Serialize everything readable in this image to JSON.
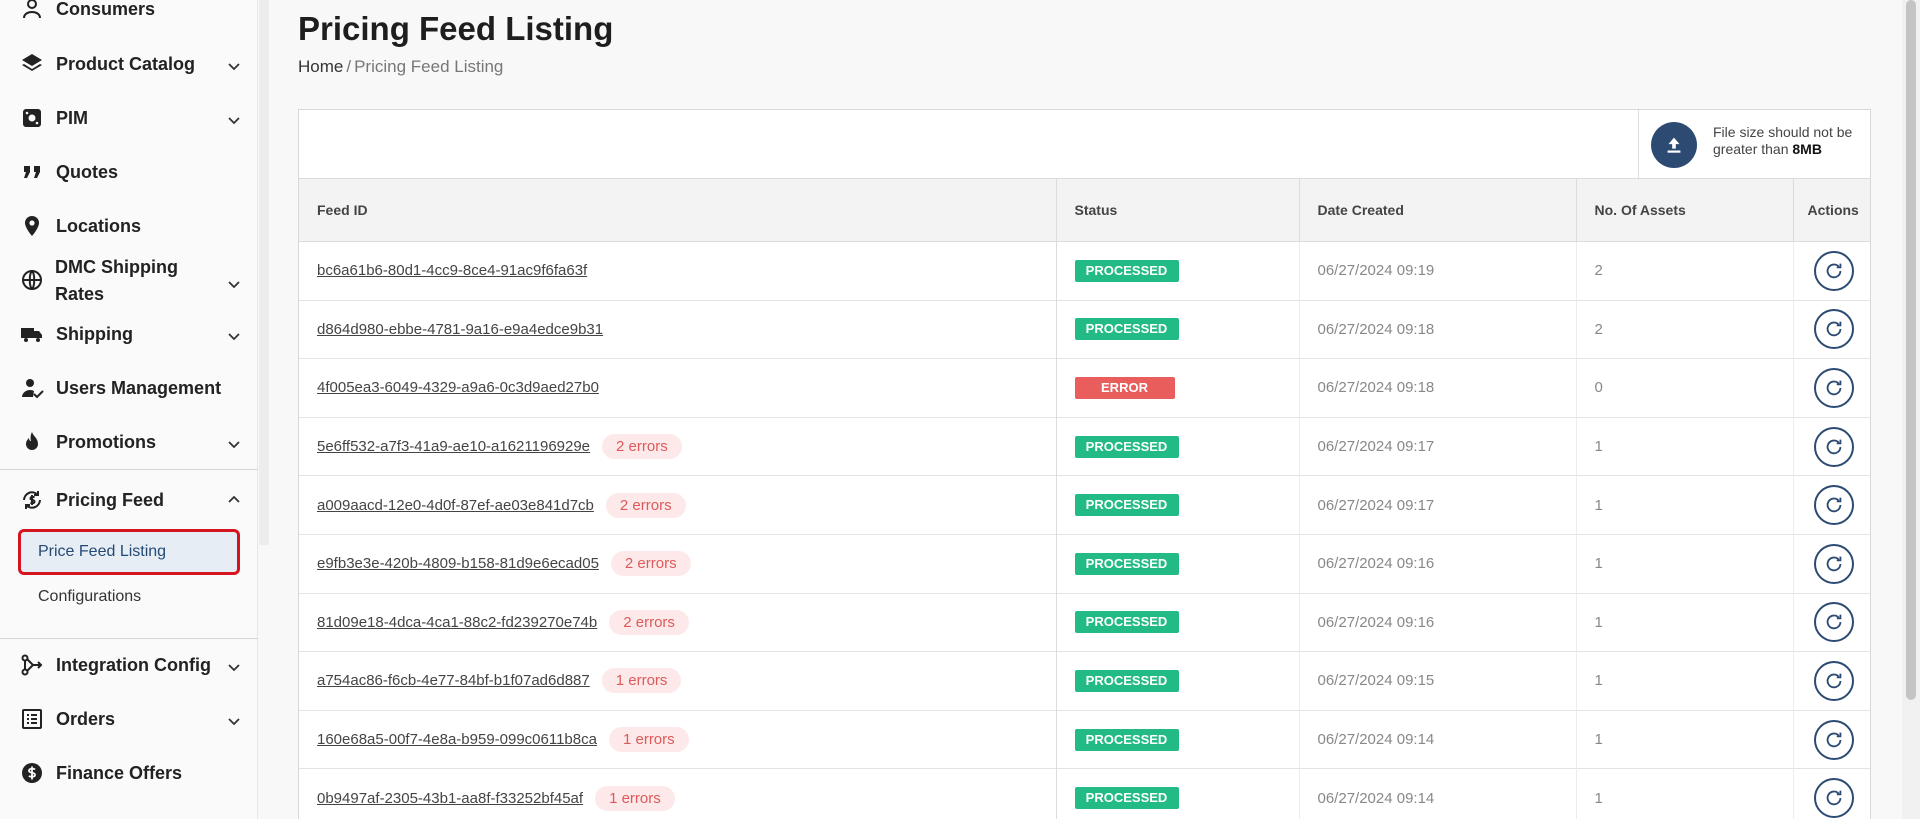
{
  "sidebar": {
    "items": [
      {
        "label": "Consumers",
        "icon": "user-icon",
        "chevron": false
      },
      {
        "label": "Product Catalog",
        "icon": "layers-icon",
        "chevron": true
      },
      {
        "label": "PIM",
        "icon": "pim-icon",
        "chevron": true
      },
      {
        "label": "Quotes",
        "icon": "quote-icon",
        "chevron": false
      },
      {
        "label": "Locations",
        "icon": "location-pin-icon",
        "chevron": false
      },
      {
        "label": "DMC Shipping Rates",
        "label_line1": "DMC Shipping",
        "label_line2": "Rates",
        "icon": "globe-icon",
        "chevron": true
      },
      {
        "label": "Shipping",
        "icon": "truck-icon",
        "chevron": true
      },
      {
        "label": "Users Management",
        "icon": "user-check-icon",
        "chevron": false
      },
      {
        "label": "Promotions",
        "icon": "fire-icon",
        "chevron": true
      },
      {
        "label": "Pricing Feed",
        "icon": "dollar-cycle-icon",
        "chevron": true,
        "expanded": true
      },
      {
        "label": "Integration Config",
        "icon": "integration-icon",
        "chevron": true
      },
      {
        "label": "Orders",
        "icon": "list-icon",
        "chevron": true
      },
      {
        "label": "Finance Offers",
        "icon": "dollar-circle-icon",
        "chevron": false
      }
    ],
    "sub_items": [
      {
        "label": "Price Feed Listing",
        "active": true
      },
      {
        "label": "Configurations",
        "active": false
      }
    ]
  },
  "page": {
    "title": "Pricing Feed Listing",
    "breadcrumb_home": "Home",
    "breadcrumb_sep": "/",
    "breadcrumb_current": "Pricing Feed Listing"
  },
  "upload": {
    "note_prefix": "File size should not be greater than",
    "note_limit": "8MB"
  },
  "table": {
    "headers": [
      "Feed ID",
      "Status",
      "Date Created",
      "No. Of Assets",
      "Actions"
    ],
    "rows": [
      {
        "id": "bc6a61b6-80d1-4cc9-8ce4-91ac9f6fa63f",
        "errors": "",
        "status": "PROCESSED",
        "date": "06/27/2024 09:19",
        "assets": "2"
      },
      {
        "id": "d864d980-ebbe-4781-9a16-e9a4edce9b31",
        "errors": "",
        "status": "PROCESSED",
        "date": "06/27/2024 09:18",
        "assets": "2"
      },
      {
        "id": "4f005ea3-6049-4329-a9a6-0c3d9aed27b0",
        "errors": "",
        "status": "ERROR",
        "date": "06/27/2024 09:18",
        "assets": "0"
      },
      {
        "id": "5e6ff532-a7f3-41a9-ae10-a1621196929e",
        "errors": "2 errors",
        "status": "PROCESSED",
        "date": "06/27/2024 09:17",
        "assets": "1"
      },
      {
        "id": "a009aacd-12e0-4d0f-87ef-ae03e841d7cb",
        "errors": "2 errors",
        "status": "PROCESSED",
        "date": "06/27/2024 09:17",
        "assets": "1"
      },
      {
        "id": "e9fb3e3e-420b-4809-b158-81d9e6ecad05",
        "errors": "2 errors",
        "status": "PROCESSED",
        "date": "06/27/2024 09:16",
        "assets": "1"
      },
      {
        "id": "81d09e18-4dca-4ca1-88c2-fd239270e74b",
        "errors": "2 errors",
        "status": "PROCESSED",
        "date": "06/27/2024 09:16",
        "assets": "1"
      },
      {
        "id": "a754ac86-f6cb-4e77-84bf-b1f07ad6d887",
        "errors": "1 errors",
        "status": "PROCESSED",
        "date": "06/27/2024 09:15",
        "assets": "1"
      },
      {
        "id": "160e68a5-00f7-4e8a-b959-099c0611b8ca",
        "errors": "1 errors",
        "status": "PROCESSED",
        "date": "06/27/2024 09:14",
        "assets": "1"
      },
      {
        "id": "0b9497af-2305-43b1-aa8f-f33252bf45af",
        "errors": "1 errors",
        "status": "PROCESSED",
        "date": "06/27/2024 09:14",
        "assets": "1"
      }
    ]
  },
  "colors": {
    "accent": "#2c4a72",
    "processed": "#22bb85",
    "error": "#ea5d5d",
    "active_outline": "#d6141f"
  }
}
